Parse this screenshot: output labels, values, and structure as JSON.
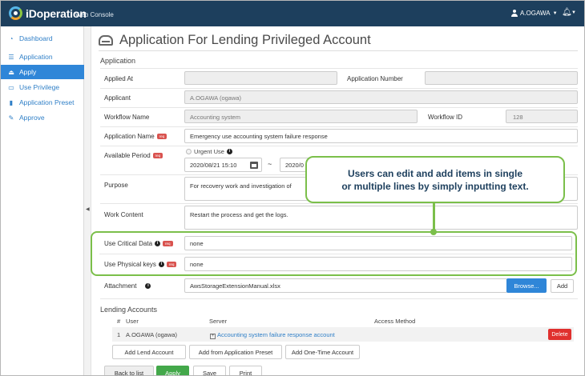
{
  "header": {
    "brand": "iDoperation",
    "brand_sub": "Web Console",
    "user": "A.OGAWA"
  },
  "sidebar": {
    "items": [
      {
        "label": "Dashboard",
        "icon": "dashboard-icon"
      },
      {
        "label": "Application",
        "icon": "list-icon"
      },
      {
        "label": "Apply",
        "icon": "tray-icon",
        "active": true
      },
      {
        "label": "Use Privilege",
        "icon": "laptop-icon"
      },
      {
        "label": "Application Preset",
        "icon": "bookmark-icon"
      },
      {
        "label": "Approve",
        "icon": "edit-icon"
      }
    ]
  },
  "page": {
    "title": "Application For Lending Privileged Account",
    "section_application": "Application",
    "req_badge": "req"
  },
  "form": {
    "applied_at_label": "Applied At",
    "applied_at_value": "",
    "application_number_label": "Application Number",
    "application_number_value": "",
    "applicant_label": "Applicant",
    "applicant_value": "A.OGAWA (ogawa)",
    "workflow_name_label": "Workflow Name",
    "workflow_name_value": "Accounting system",
    "workflow_id_label": "Workflow ID",
    "workflow_id_value": "128",
    "application_name_label": "Application Name",
    "application_name_value": "Emergency use accounting system failure response",
    "available_period_label": "Available Period",
    "urgent_use_label": "Urgent Use",
    "period_start": "2020/08/21 15:10",
    "period_separator": "~",
    "period_end": "2020/0",
    "purpose_label": "Purpose",
    "purpose_value": "For recovery work and investigation of",
    "work_content_label": "Work Content",
    "work_content_value": "Restart the process and get the logs.",
    "critical_data_label": "Use Critical Data",
    "critical_data_value": "none",
    "physical_keys_label": "Use Physical keys",
    "physical_keys_value": "none",
    "attachment_label": "Attachment",
    "attachment_value": "AwsStorageExtensionManual.xlsx",
    "browse_label": "Browse...",
    "add_label": "Add"
  },
  "lending": {
    "title": "Lending Accounts",
    "columns": [
      "#",
      "User",
      "Server",
      "Access Method"
    ],
    "rows": [
      {
        "num": "1",
        "user": "A.OGAWA (ogawa)",
        "server": "Accounting system failure response account",
        "delete": "Delete"
      }
    ],
    "add_lend_account": "Add Lend Account",
    "add_from_preset": "Add from Application Preset",
    "add_one_time": "Add One-Time Account"
  },
  "footer_buttons": {
    "back": "Back to list",
    "apply": "Apply",
    "save": "Save",
    "print": "Print"
  },
  "callout": {
    "line1": "Users can edit and add items in single",
    "line2": "or multiple lines by simply inputting text."
  },
  "colors": {
    "header_bg": "#1d3f5d",
    "accent": "#2f86d8",
    "callout_green": "#7bbf4a",
    "danger": "#e0302e",
    "success": "#43a84a"
  }
}
